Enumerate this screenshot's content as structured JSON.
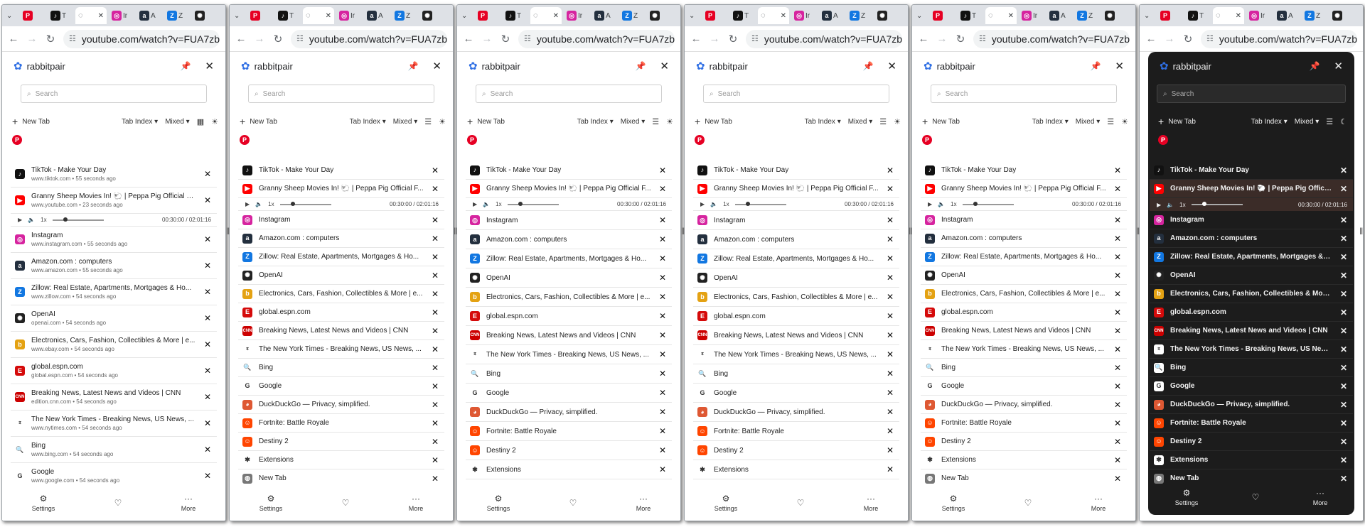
{
  "window": {
    "url": "youtube.com/watch?v=FUA7zbEvW",
    "tab_titles": [
      "",
      "T",
      "",
      "Ir",
      "A",
      "Z",
      ""
    ]
  },
  "panel": {
    "app_name": "rabbitpair",
    "search_placeholder": "Search",
    "new_tab_label": "New Tab",
    "sort_label": "Tab Index",
    "mode_label": "Mixed",
    "footer": {
      "settings": "Settings",
      "more": "More"
    }
  },
  "media": {
    "speed": "1x",
    "time": "00:30:00 / 02:01:16",
    "progress": 0.25
  },
  "tabs_detailed": [
    {
      "title": "TikTok - Make Your Day",
      "sub": "www.tiktok.com • 55 seconds ago",
      "icon": "tiktok"
    },
    {
      "title": "Granny Sheep Movies In! 🐑 | Peppa Pig Official Fa...",
      "sub": "www.youtube.com • 23 seconds ago",
      "icon": "youtube"
    },
    {
      "title": "Instagram",
      "sub": "www.instagram.com • 55 seconds ago",
      "icon": "instagram"
    },
    {
      "title": "Amazon.com : computers",
      "sub": "www.amazon.com • 55 seconds ago",
      "icon": "amazon"
    },
    {
      "title": "Zillow: Real Estate, Apartments, Mortgages & Ho...",
      "sub": "www.zillow.com • 54 seconds ago",
      "icon": "zillow"
    },
    {
      "title": "OpenAI",
      "sub": "openai.com • 54 seconds ago",
      "icon": "openai"
    },
    {
      "title": "Electronics, Cars, Fashion, Collectibles & More | e...",
      "sub": "www.ebay.com • 54 seconds ago",
      "icon": "ebay"
    },
    {
      "title": "global.espn.com",
      "sub": "global.espn.com • 54 seconds ago",
      "icon": "espn"
    },
    {
      "title": "Breaking News, Latest News and Videos | CNN",
      "sub": "edition.cnn.com • 54 seconds ago",
      "icon": "cnn"
    },
    {
      "title": "The New York Times - Breaking News, US News, ...",
      "sub": "www.nytimes.com • 54 seconds ago",
      "icon": "nyt"
    },
    {
      "title": "Bing",
      "sub": "www.bing.com • 54 seconds ago",
      "icon": "bing"
    },
    {
      "title": "Google",
      "sub": "www.google.com • 54 seconds ago",
      "icon": "google"
    }
  ],
  "tabs_compact": [
    {
      "title": "TikTok - Make Your Day",
      "icon": "tiktok"
    },
    {
      "title": "Granny Sheep Movies In! 🐑 | Peppa Pig Official F...",
      "icon": "youtube"
    },
    {
      "title": "Instagram",
      "icon": "instagram"
    },
    {
      "title": "Amazon.com : computers",
      "icon": "amazon"
    },
    {
      "title": "Zillow: Real Estate, Apartments, Mortgages & Ho...",
      "icon": "zillow"
    },
    {
      "title": "OpenAI",
      "icon": "openai"
    },
    {
      "title": "Electronics, Cars, Fashion, Collectibles & More | e...",
      "icon": "ebay"
    },
    {
      "title": "global.espn.com",
      "icon": "espn"
    },
    {
      "title": "Breaking News, Latest News and Videos | CNN",
      "icon": "cnn"
    },
    {
      "title": "The New York Times - Breaking News, US News, ...",
      "icon": "nyt"
    },
    {
      "title": "Bing",
      "icon": "bing"
    },
    {
      "title": "Google",
      "icon": "google"
    },
    {
      "title": "DuckDuckGo — Privacy, simplified.",
      "icon": "duckduckgo"
    },
    {
      "title": "Fortnite: Battle Royale",
      "icon": "reddit"
    },
    {
      "title": "Destiny 2",
      "icon": "reddit"
    },
    {
      "title": "Extensions",
      "icon": "puzzle"
    },
    {
      "title": "New Tab",
      "icon": "globe"
    }
  ],
  "icons": {
    "tiktok": {
      "bg": "#111111",
      "glyph": "♪"
    },
    "youtube": {
      "bg": "#ff0000",
      "glyph": "▶"
    },
    "instagram": {
      "bg": "#d6249f",
      "glyph": "◎"
    },
    "amazon": {
      "bg": "#232f3e",
      "glyph": "a"
    },
    "zillow": {
      "bg": "#1277e1",
      "glyph": "Z"
    },
    "openai": {
      "bg": "#222222",
      "glyph": "✺"
    },
    "ebay": {
      "bg": "#e4a213",
      "glyph": "b"
    },
    "espn": {
      "bg": "#d50a0a",
      "glyph": "E"
    },
    "cnn": {
      "bg": "#cc0000",
      "glyph": "CNN"
    },
    "nyt": {
      "bg": "#ffffff",
      "glyph": "𝕿"
    },
    "bing": {
      "bg": "#ffffff",
      "glyph": "🔍"
    },
    "google": {
      "bg": "#ffffff",
      "glyph": "G"
    },
    "duckduckgo": {
      "bg": "#de5833",
      "glyph": "◕"
    },
    "reddit": {
      "bg": "#ff4500",
      "glyph": "☺"
    },
    "puzzle": {
      "bg": "#ffffff",
      "glyph": "✱"
    },
    "globe": {
      "bg": "#777777",
      "glyph": "◍"
    },
    "pinterest": {
      "bg": "#e60023",
      "glyph": "P"
    }
  },
  "colors": {
    "accent": "#2f6fe4",
    "dark_bg": "#1c1c1c",
    "dark_media": "#3b2c28"
  }
}
